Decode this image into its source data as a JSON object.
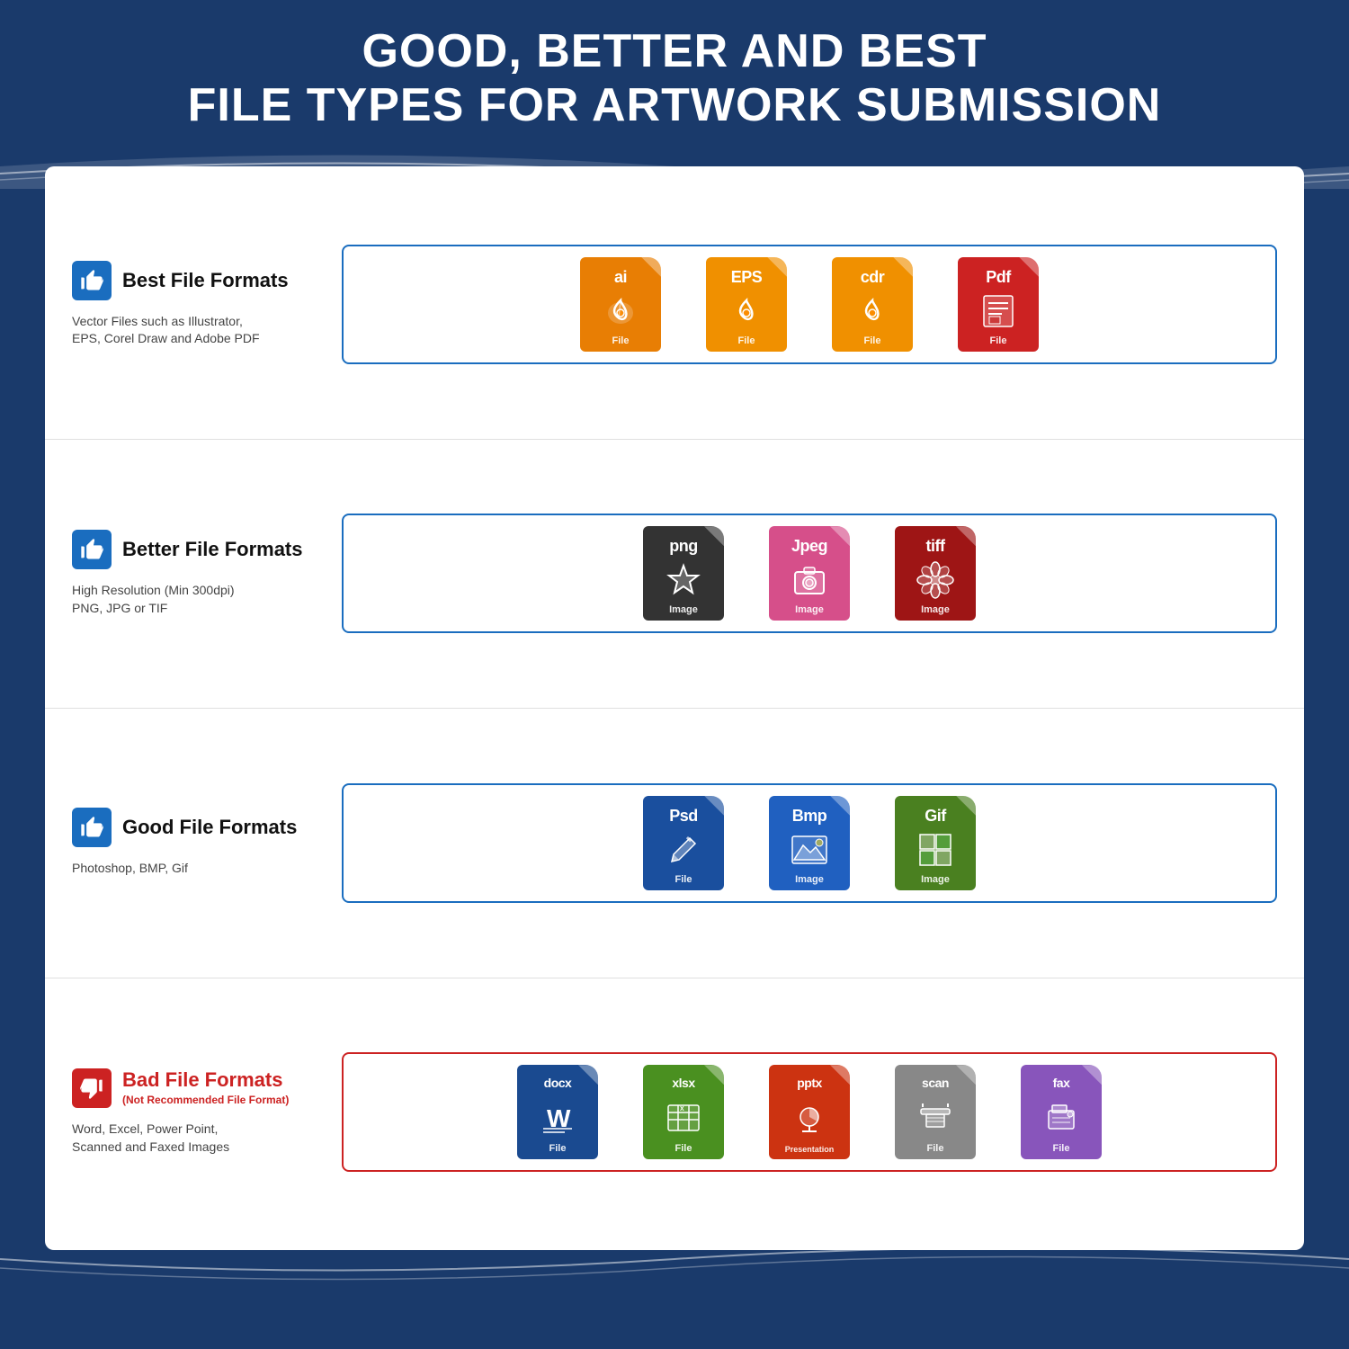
{
  "header": {
    "line1": "GOOD, BETTER AND BEST",
    "line2": "FILE TYPES FOR ARTWORK SUBMISSION"
  },
  "rows": [
    {
      "id": "best",
      "thumb": "thumbs-up",
      "title": "Best File Formats",
      "subtitle": "Vector Files such as Illustrator,\nEPS, Corel Draw and Adobe PDF",
      "borderColor": "blue",
      "files": [
        {
          "ext": "ai",
          "color": "orange",
          "label": "File",
          "iconType": "pen"
        },
        {
          "ext": "EPS",
          "color": "orange2",
          "label": "File",
          "iconType": "pen"
        },
        {
          "ext": "cdr",
          "color": "orange2",
          "label": "File",
          "iconType": "pen"
        },
        {
          "ext": "Pdf",
          "color": "red-file",
          "label": "File",
          "iconType": "doc"
        }
      ]
    },
    {
      "id": "better",
      "thumb": "thumbs-up",
      "title": "Better File Formats",
      "subtitle": "High Resolution (Min 300dpi)\nPNG, JPG or TIF",
      "borderColor": "blue",
      "files": [
        {
          "ext": "png",
          "color": "dark-gray",
          "label": "Image",
          "iconType": "star"
        },
        {
          "ext": "Jpeg",
          "color": "pink",
          "label": "Image",
          "iconType": "camera"
        },
        {
          "ext": "tiff",
          "color": "dark-red",
          "label": "Image",
          "iconType": "flower"
        }
      ]
    },
    {
      "id": "good",
      "thumb": "thumbs-up",
      "title": "Good File Formats",
      "subtitle": "Photoshop, BMP, Gif",
      "borderColor": "blue",
      "files": [
        {
          "ext": "Psd",
          "color": "navy",
          "label": "File",
          "iconType": "brush"
        },
        {
          "ext": "Bmp",
          "color": "blue",
          "label": "Image",
          "iconType": "mountain"
        },
        {
          "ext": "Gif",
          "color": "green",
          "label": "Image",
          "iconType": "grid"
        }
      ]
    },
    {
      "id": "bad",
      "thumb": "thumbs-down",
      "title": "Bad File Formats",
      "titleSub": "(Not Recommended File Format)",
      "subtitle": "Word, Excel, Power Point,\nScanned and Faxed Images",
      "borderColor": "red",
      "files": [
        {
          "ext": "docx",
          "color": "blue-doc",
          "label": "File",
          "iconType": "word"
        },
        {
          "ext": "xlsx",
          "color": "green-xlsx",
          "label": "File",
          "iconType": "excel"
        },
        {
          "ext": "pptx",
          "color": "red-pptx",
          "label": "Presentation",
          "iconType": "ppt"
        },
        {
          "ext": "scan",
          "color": "gray-scan",
          "label": "File",
          "iconType": "scan"
        },
        {
          "ext": "fax",
          "color": "purple-fax",
          "label": "File",
          "iconType": "fax"
        }
      ]
    }
  ]
}
